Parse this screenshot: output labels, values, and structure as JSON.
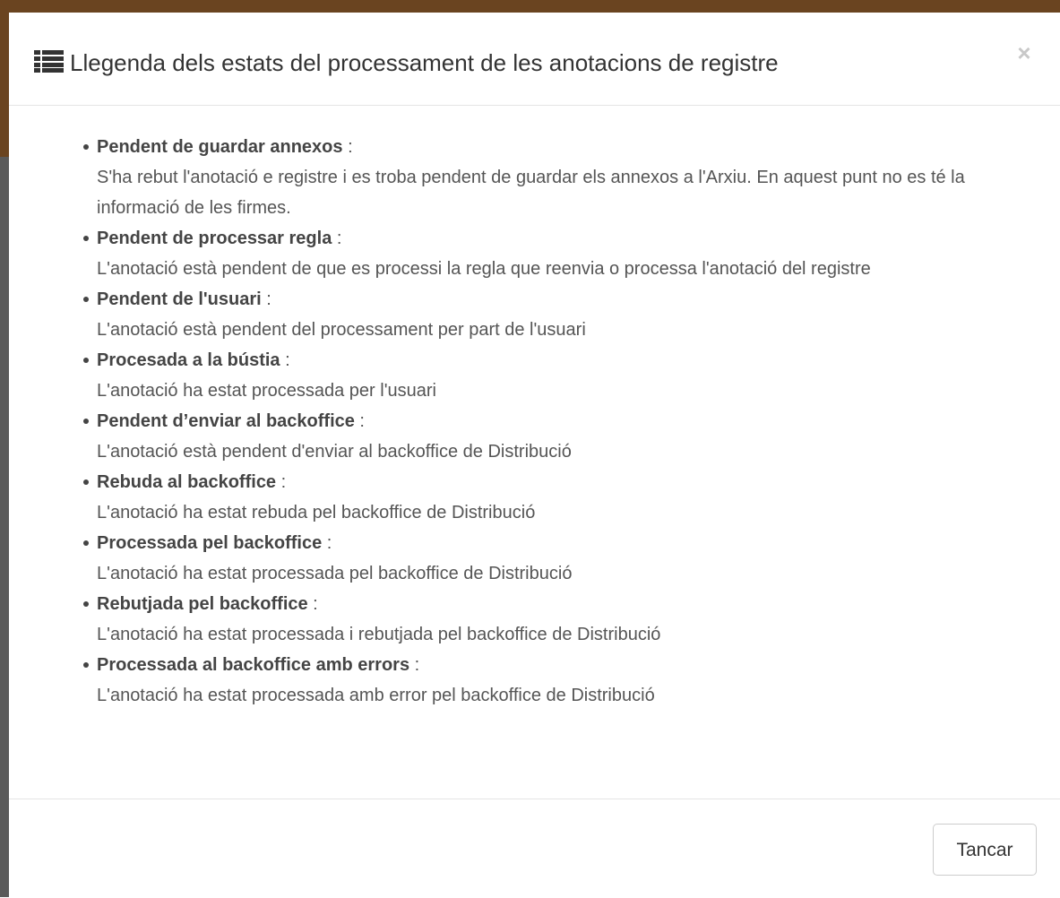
{
  "modal": {
    "title": "Llegenda dels estats del processament de les anotacions de registre",
    "title_icon": "list-icon",
    "close_icon_glyph": "×",
    "close_button_label": "Tancar"
  },
  "statuses": [
    {
      "name": "Pendent de guardar annexos",
      "separator": " :",
      "description": "S'ha rebut l'anotació e registre i es troba pendent de guardar els annexos a l'Arxiu. En aquest punt no es té la informació de les firmes."
    },
    {
      "name": "Pendent de processar regla",
      "separator": " :",
      "description": "L'anotació està pendent de que es processi la regla que reenvia o processa l'anotació del registre"
    },
    {
      "name": "Pendent de l'usuari",
      "separator": " :",
      "description": "L'anotació està pendent del processament per part de l'usuari"
    },
    {
      "name": "Procesada a la bústia",
      "separator": " :",
      "description": "L'anotació ha estat processada per l'usuari"
    },
    {
      "name": "Pendent d’enviar al backoffice",
      "separator": " :",
      "description": "L'anotació està pendent d'enviar al backoffice de Distribució"
    },
    {
      "name": "Rebuda al backoffice",
      "separator": " :",
      "description": "L'anotació ha estat rebuda pel backoffice de Distribució"
    },
    {
      "name": "Processada pel backoffice",
      "separator": " :",
      "description": "L'anotació ha estat processada pel backoffice de Distribució"
    },
    {
      "name": "Rebutjada pel backoffice",
      "separator": " :",
      "description": "L'anotació ha estat processada i rebutjada pel backoffice de Distribució"
    },
    {
      "name": "Processada al backoffice amb errors",
      "separator": " :",
      "description": "L'anotació ha estat processada amb error pel backoffice de Distribució"
    }
  ],
  "colors": {
    "backdrop_brown": "#6a4420",
    "backdrop_gray": "#5a5a5a",
    "text": "#333333",
    "muted_text": "#555555",
    "border": "#e5e5e5"
  }
}
